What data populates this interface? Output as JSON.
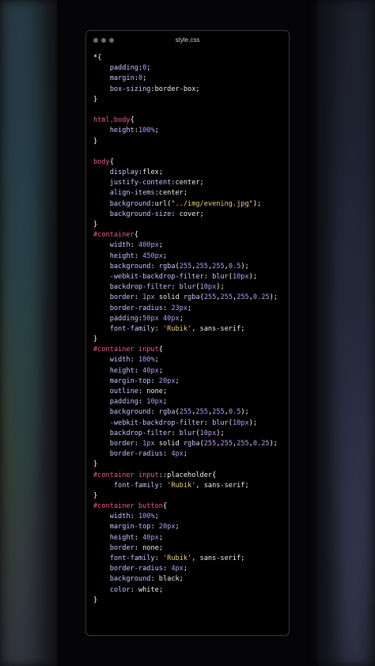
{
  "window": {
    "filename": "style.css"
  },
  "code_lines": [
    [
      {
        "t": "*",
        "c": "brace"
      },
      {
        "t": "{",
        "c": "brace"
      }
    ],
    [
      {
        "t": "    padding",
        "c": "prop"
      },
      {
        "t": ":",
        "c": "punc"
      },
      {
        "t": "0",
        "c": "num"
      },
      {
        "t": ";",
        "c": "punc"
      }
    ],
    [
      {
        "t": "    margin",
        "c": "prop"
      },
      {
        "t": ":",
        "c": "punc"
      },
      {
        "t": "0",
        "c": "num"
      },
      {
        "t": ";",
        "c": "punc"
      }
    ],
    [
      {
        "t": "    box-sizing",
        "c": "prop"
      },
      {
        "t": ":",
        "c": "punc"
      },
      {
        "t": "border-box",
        "c": "val"
      },
      {
        "t": ";",
        "c": "punc"
      }
    ],
    [
      {
        "t": "}",
        "c": "brace"
      }
    ],
    [],
    [
      {
        "t": "html,body",
        "c": "sel"
      },
      {
        "t": "{",
        "c": "brace"
      }
    ],
    [
      {
        "t": "    height",
        "c": "prop"
      },
      {
        "t": ":",
        "c": "punc"
      },
      {
        "t": "100%",
        "c": "num"
      },
      {
        "t": ";",
        "c": "punc"
      }
    ],
    [
      {
        "t": "}",
        "c": "brace"
      }
    ],
    [],
    [
      {
        "t": "body",
        "c": "sel"
      },
      {
        "t": "{",
        "c": "brace"
      }
    ],
    [
      {
        "t": "    display",
        "c": "prop"
      },
      {
        "t": ":",
        "c": "punc"
      },
      {
        "t": "flex",
        "c": "val"
      },
      {
        "t": ";",
        "c": "punc"
      }
    ],
    [
      {
        "t": "    justify-content",
        "c": "prop"
      },
      {
        "t": ":",
        "c": "punc"
      },
      {
        "t": "center",
        "c": "val"
      },
      {
        "t": ";",
        "c": "punc"
      }
    ],
    [
      {
        "t": "    align-items",
        "c": "prop"
      },
      {
        "t": ":",
        "c": "punc"
      },
      {
        "t": "center",
        "c": "val"
      },
      {
        "t": ";",
        "c": "punc"
      }
    ],
    [
      {
        "t": "    background",
        "c": "prop"
      },
      {
        "t": ":",
        "c": "punc"
      },
      {
        "t": "url(",
        "c": "val"
      },
      {
        "t": "\"../img/evening.jpg\"",
        "c": "str"
      },
      {
        "t": ");",
        "c": "punc"
      }
    ],
    [
      {
        "t": "    background-size",
        "c": "prop"
      },
      {
        "t": ": ",
        "c": "punc"
      },
      {
        "t": "cover",
        "c": "val"
      },
      {
        "t": ";",
        "c": "punc"
      }
    ],
    [
      {
        "t": "}",
        "c": "brace"
      }
    ],
    [
      {
        "t": "#container",
        "c": "sel"
      },
      {
        "t": "{",
        "c": "brace"
      }
    ],
    [
      {
        "t": "    width",
        "c": "prop"
      },
      {
        "t": ": ",
        "c": "punc"
      },
      {
        "t": "400px",
        "c": "num"
      },
      {
        "t": ";",
        "c": "punc"
      }
    ],
    [
      {
        "t": "    height",
        "c": "prop"
      },
      {
        "t": ": ",
        "c": "punc"
      },
      {
        "t": "450px",
        "c": "num"
      },
      {
        "t": ";",
        "c": "punc"
      }
    ],
    [
      {
        "t": "    background",
        "c": "prop"
      },
      {
        "t": ": ",
        "c": "punc"
      },
      {
        "t": "rgba",
        "c": "fn"
      },
      {
        "t": "(",
        "c": "punc"
      },
      {
        "t": "255",
        "c": "num"
      },
      {
        "t": ",",
        "c": "punc"
      },
      {
        "t": "255",
        "c": "num"
      },
      {
        "t": ",",
        "c": "punc"
      },
      {
        "t": "255",
        "c": "num"
      },
      {
        "t": ",",
        "c": "punc"
      },
      {
        "t": "0.5",
        "c": "num"
      },
      {
        "t": ");",
        "c": "punc"
      }
    ],
    [
      {
        "t": "    -webkit-backdrop-filter",
        "c": "prop"
      },
      {
        "t": ": ",
        "c": "punc"
      },
      {
        "t": "blur",
        "c": "fn"
      },
      {
        "t": "(",
        "c": "punc"
      },
      {
        "t": "10px",
        "c": "num"
      },
      {
        "t": ");",
        "c": "punc"
      }
    ],
    [
      {
        "t": "    backdrop-filter",
        "c": "prop"
      },
      {
        "t": ": ",
        "c": "punc"
      },
      {
        "t": "blur",
        "c": "fn"
      },
      {
        "t": "(",
        "c": "punc"
      },
      {
        "t": "10px",
        "c": "num"
      },
      {
        "t": ");",
        "c": "punc"
      }
    ],
    [
      {
        "t": "    border",
        "c": "prop"
      },
      {
        "t": ": ",
        "c": "punc"
      },
      {
        "t": "1px",
        "c": "num"
      },
      {
        "t": " solid ",
        "c": "val"
      },
      {
        "t": "rgba",
        "c": "fn"
      },
      {
        "t": "(",
        "c": "punc"
      },
      {
        "t": "255",
        "c": "num"
      },
      {
        "t": ",",
        "c": "punc"
      },
      {
        "t": "255",
        "c": "num"
      },
      {
        "t": ",",
        "c": "punc"
      },
      {
        "t": "255",
        "c": "num"
      },
      {
        "t": ",",
        "c": "punc"
      },
      {
        "t": "0.25",
        "c": "num"
      },
      {
        "t": ");",
        "c": "punc"
      }
    ],
    [
      {
        "t": "    border-radius",
        "c": "prop"
      },
      {
        "t": ": ",
        "c": "punc"
      },
      {
        "t": "23px",
        "c": "num"
      },
      {
        "t": ";",
        "c": "punc"
      }
    ],
    [
      {
        "t": "    padding",
        "c": "prop"
      },
      {
        "t": ":",
        "c": "punc"
      },
      {
        "t": "50px 40px",
        "c": "num"
      },
      {
        "t": ";",
        "c": "punc"
      }
    ],
    [
      {
        "t": "    font-family",
        "c": "prop"
      },
      {
        "t": ": ",
        "c": "punc"
      },
      {
        "t": "'Rubik'",
        "c": "str"
      },
      {
        "t": ", sans-serif;",
        "c": "val"
      }
    ],
    [
      {
        "t": "}",
        "c": "brace"
      }
    ],
    [
      {
        "t": "#container input",
        "c": "sel"
      },
      {
        "t": "{",
        "c": "brace"
      }
    ],
    [
      {
        "t": "    width",
        "c": "prop"
      },
      {
        "t": ": ",
        "c": "punc"
      },
      {
        "t": "100%",
        "c": "num"
      },
      {
        "t": ";",
        "c": "punc"
      }
    ],
    [
      {
        "t": "    height",
        "c": "prop"
      },
      {
        "t": ": ",
        "c": "punc"
      },
      {
        "t": "40px",
        "c": "num"
      },
      {
        "t": ";",
        "c": "punc"
      }
    ],
    [
      {
        "t": "    margin-top",
        "c": "prop"
      },
      {
        "t": ": ",
        "c": "punc"
      },
      {
        "t": "20px",
        "c": "num"
      },
      {
        "t": ";",
        "c": "punc"
      }
    ],
    [
      {
        "t": "    outline",
        "c": "prop"
      },
      {
        "t": ": ",
        "c": "punc"
      },
      {
        "t": "none",
        "c": "val"
      },
      {
        "t": ";",
        "c": "punc"
      }
    ],
    [
      {
        "t": "    padding",
        "c": "prop"
      },
      {
        "t": ": ",
        "c": "punc"
      },
      {
        "t": "10px",
        "c": "num"
      },
      {
        "t": ";",
        "c": "punc"
      }
    ],
    [
      {
        "t": "    background",
        "c": "prop"
      },
      {
        "t": ": ",
        "c": "punc"
      },
      {
        "t": "rgba",
        "c": "fn"
      },
      {
        "t": "(",
        "c": "punc"
      },
      {
        "t": "255",
        "c": "num"
      },
      {
        "t": ",",
        "c": "punc"
      },
      {
        "t": "255",
        "c": "num"
      },
      {
        "t": ",",
        "c": "punc"
      },
      {
        "t": "255",
        "c": "num"
      },
      {
        "t": ",",
        "c": "punc"
      },
      {
        "t": "0.5",
        "c": "num"
      },
      {
        "t": ");",
        "c": "punc"
      }
    ],
    [
      {
        "t": "    -webkit-backdrop-filter",
        "c": "prop"
      },
      {
        "t": ": ",
        "c": "punc"
      },
      {
        "t": "blur",
        "c": "fn"
      },
      {
        "t": "(",
        "c": "punc"
      },
      {
        "t": "10px",
        "c": "num"
      },
      {
        "t": ");",
        "c": "punc"
      }
    ],
    [
      {
        "t": "    backdrop-filter",
        "c": "prop"
      },
      {
        "t": ": ",
        "c": "punc"
      },
      {
        "t": "blur",
        "c": "fn"
      },
      {
        "t": "(",
        "c": "punc"
      },
      {
        "t": "10px",
        "c": "num"
      },
      {
        "t": ");",
        "c": "punc"
      }
    ],
    [
      {
        "t": "    border",
        "c": "prop"
      },
      {
        "t": ": ",
        "c": "punc"
      },
      {
        "t": "1px",
        "c": "num"
      },
      {
        "t": " solid ",
        "c": "val"
      },
      {
        "t": "rgba",
        "c": "fn"
      },
      {
        "t": "(",
        "c": "punc"
      },
      {
        "t": "255",
        "c": "num"
      },
      {
        "t": ",",
        "c": "punc"
      },
      {
        "t": "255",
        "c": "num"
      },
      {
        "t": ",",
        "c": "punc"
      },
      {
        "t": "255",
        "c": "num"
      },
      {
        "t": ",",
        "c": "punc"
      },
      {
        "t": "0.25",
        "c": "num"
      },
      {
        "t": ");",
        "c": "punc"
      }
    ],
    [
      {
        "t": "    border-radius",
        "c": "prop"
      },
      {
        "t": ": ",
        "c": "punc"
      },
      {
        "t": "4px",
        "c": "num"
      },
      {
        "t": ";",
        "c": "punc"
      }
    ],
    [
      {
        "t": "}",
        "c": "brace"
      }
    ],
    [
      {
        "t": "#container input",
        "c": "sel"
      },
      {
        "t": "::placeholder",
        "c": "val"
      },
      {
        "t": "{",
        "c": "brace"
      }
    ],
    [
      {
        "t": "     font-family",
        "c": "prop"
      },
      {
        "t": ": ",
        "c": "punc"
      },
      {
        "t": "'Rubik'",
        "c": "str"
      },
      {
        "t": ", sans-serif;",
        "c": "val"
      }
    ],
    [
      {
        "t": "}",
        "c": "brace"
      }
    ],
    [
      {
        "t": "#container button",
        "c": "sel"
      },
      {
        "t": "{",
        "c": "brace"
      }
    ],
    [
      {
        "t": "    width",
        "c": "prop"
      },
      {
        "t": ": ",
        "c": "punc"
      },
      {
        "t": "100%",
        "c": "num"
      },
      {
        "t": ";",
        "c": "punc"
      }
    ],
    [
      {
        "t": "    margin-top",
        "c": "prop"
      },
      {
        "t": ": ",
        "c": "punc"
      },
      {
        "t": "20px",
        "c": "num"
      },
      {
        "t": ";",
        "c": "punc"
      }
    ],
    [
      {
        "t": "    height",
        "c": "prop"
      },
      {
        "t": ": ",
        "c": "punc"
      },
      {
        "t": "40px",
        "c": "num"
      },
      {
        "t": ";",
        "c": "punc"
      }
    ],
    [
      {
        "t": "    border",
        "c": "prop"
      },
      {
        "t": ": ",
        "c": "punc"
      },
      {
        "t": "none",
        "c": "val"
      },
      {
        "t": ";",
        "c": "punc"
      }
    ],
    [
      {
        "t": "    font-family",
        "c": "prop"
      },
      {
        "t": ": ",
        "c": "punc"
      },
      {
        "t": "'Rubik'",
        "c": "str"
      },
      {
        "t": ", sans-serif;",
        "c": "val"
      }
    ],
    [
      {
        "t": "    border-radius",
        "c": "prop"
      },
      {
        "t": ": ",
        "c": "punc"
      },
      {
        "t": "4px",
        "c": "num"
      },
      {
        "t": ";",
        "c": "punc"
      }
    ],
    [
      {
        "t": "    background",
        "c": "prop"
      },
      {
        "t": ": ",
        "c": "punc"
      },
      {
        "t": "black",
        "c": "val"
      },
      {
        "t": ";",
        "c": "punc"
      }
    ],
    [
      {
        "t": "    color",
        "c": "prop"
      },
      {
        "t": ": ",
        "c": "punc"
      },
      {
        "t": "white",
        "c": "val"
      },
      {
        "t": ";",
        "c": "punc"
      }
    ],
    [
      {
        "t": "}",
        "c": "brace"
      }
    ]
  ],
  "colors": {
    "selector": "#e5608a",
    "property": "#c6c8ff",
    "number": "#b99cf7",
    "string": "#f3d07a"
  }
}
